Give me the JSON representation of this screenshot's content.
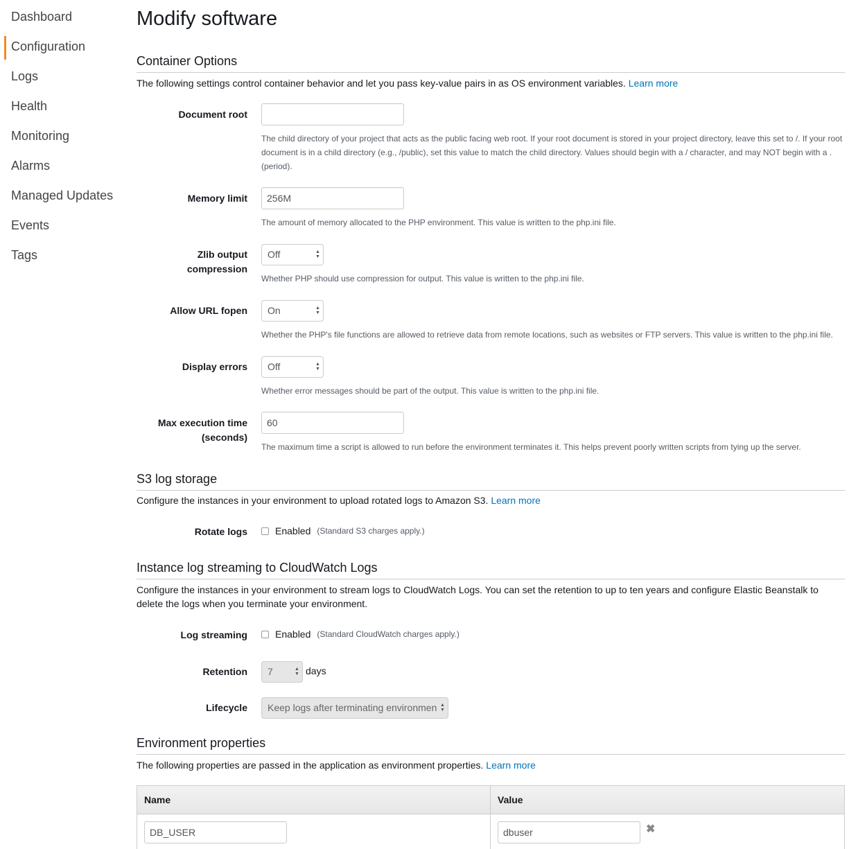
{
  "sidebar": {
    "items": [
      {
        "label": "Dashboard",
        "active": false
      },
      {
        "label": "Configuration",
        "active": true
      },
      {
        "label": "Logs",
        "active": false
      },
      {
        "label": "Health",
        "active": false
      },
      {
        "label": "Monitoring",
        "active": false
      },
      {
        "label": "Alarms",
        "active": false
      },
      {
        "label": "Managed Updates",
        "active": false
      },
      {
        "label": "Events",
        "active": false
      },
      {
        "label": "Tags",
        "active": false
      }
    ]
  },
  "page": {
    "title": "Modify software"
  },
  "container_options": {
    "title": "Container Options",
    "description": "The following settings control container behavior and let you pass key-value pairs in as OS environment variables.",
    "learn_more": "Learn more",
    "document_root": {
      "label": "Document root",
      "value": "",
      "help": "The child directory of your project that acts as the public facing web root. If your root document is stored in your project directory, leave this set to /. If your root document is in a child directory (e.g., /public), set this value to match the child directory. Values should begin with a / character, and may NOT begin with a . (period)."
    },
    "memory_limit": {
      "label": "Memory limit",
      "value": "256M",
      "help": "The amount of memory allocated to the PHP environment. This value is written to the php.ini file."
    },
    "zlib": {
      "label_line1": "Zlib output",
      "label_line2": "compression",
      "value": "Off",
      "help": "Whether PHP should use compression for output. This value is written to the php.ini file."
    },
    "allow_url_fopen": {
      "label": "Allow URL fopen",
      "value": "On",
      "help": "Whether the PHP's file functions are allowed to retrieve data from remote locations, such as websites or FTP servers. This value is written to the php.ini file."
    },
    "display_errors": {
      "label": "Display errors",
      "value": "Off",
      "help": "Whether error messages should be part of the output. This value is written to the php.ini file."
    },
    "max_execution_time": {
      "label_line1": "Max execution time",
      "label_line2": "(seconds)",
      "value": "60",
      "help": "The maximum time a script is allowed to run before the environment terminates it. This helps prevent poorly written scripts from tying up the server."
    }
  },
  "s3_logs": {
    "title": "S3 log storage",
    "description": "Configure the instances in your environment to upload rotated logs to Amazon S3.",
    "learn_more": "Learn more",
    "rotate_logs": {
      "label": "Rotate logs",
      "checkbox_label": "Enabled",
      "checked": false,
      "note": "(Standard S3 charges apply.)"
    }
  },
  "cloudwatch": {
    "title": "Instance log streaming to CloudWatch Logs",
    "description": "Configure the instances in your environment to stream logs to CloudWatch Logs. You can set the retention to up to ten years and configure Elastic Beanstalk to delete the logs when you terminate your environment.",
    "log_streaming": {
      "label": "Log streaming",
      "checkbox_label": "Enabled",
      "checked": false,
      "note": "(Standard CloudWatch charges apply.)"
    },
    "retention": {
      "label": "Retention",
      "value": "7",
      "unit": "days"
    },
    "lifecycle": {
      "label": "Lifecycle",
      "value": "Keep logs after terminating environmen"
    }
  },
  "env_properties": {
    "title": "Environment properties",
    "description": "The following properties are passed in the application as environment properties.",
    "learn_more": "Learn more",
    "columns": {
      "name": "Name",
      "value": "Value"
    },
    "rows": [
      {
        "name": "DB_USER",
        "value": "dbuser"
      }
    ]
  },
  "icons": {
    "select_arrows": "▲▼",
    "remove": "✖"
  },
  "colors": {
    "accent_active": "#f08a24",
    "link": "#0073bb"
  }
}
